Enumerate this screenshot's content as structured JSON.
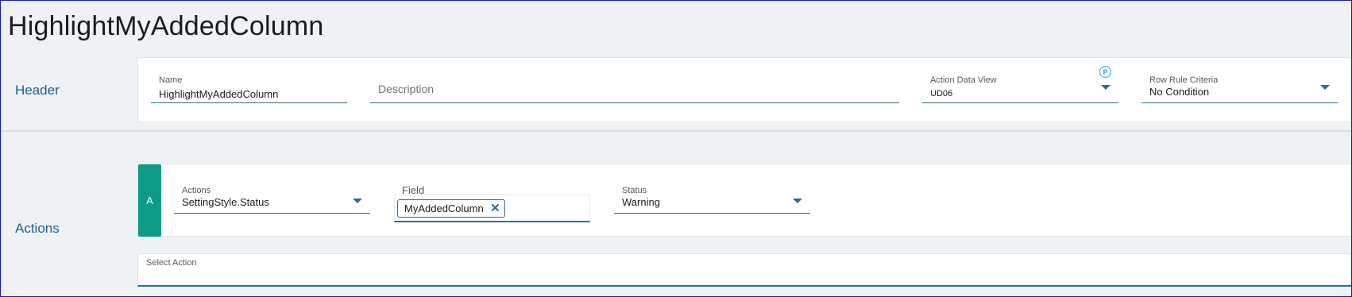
{
  "page": {
    "title": "HighlightMyAddedColumn"
  },
  "sections": {
    "header_label": "Header",
    "actions_label": "Actions"
  },
  "header": {
    "name_label": "Name",
    "name_value": "HighlightMyAddedColumn",
    "description_placeholder": "Description",
    "action_data_view_label": "Action Data View",
    "action_data_view_value": "UD06",
    "p_icon": "P",
    "row_rule_criteria_label": "Row Rule Criteria",
    "row_rule_criteria_value": "No Condition"
  },
  "action": {
    "tab_letter": "A",
    "actions_label": "Actions",
    "actions_value": "SettingStyle.Status",
    "field_label": "Field",
    "field_chip": "MyAddedColumn",
    "chip_close": "✕",
    "status_label": "Status",
    "status_value": "Warning"
  },
  "select_action": {
    "label": "Select Action"
  },
  "colors": {
    "accent": "#2a6f93",
    "tab": "#0d9a86",
    "heading": "#1e5f86"
  }
}
